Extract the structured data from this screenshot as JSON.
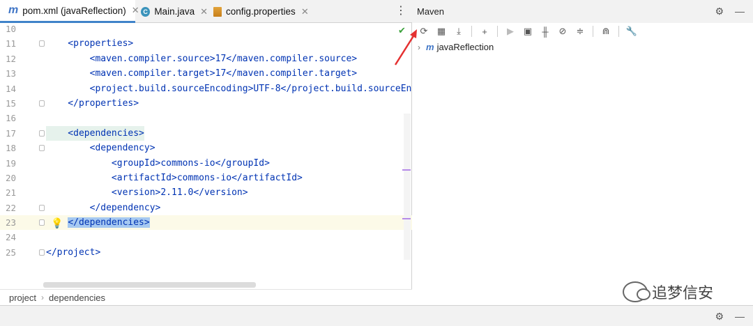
{
  "editor": {
    "tabs": [
      {
        "icon": "m",
        "label": "pom.xml (javaReflection)",
        "close": "✕"
      },
      {
        "icon": "C",
        "label": "Main.java",
        "close": "✕"
      },
      {
        "label": "config.properties",
        "close": "✕"
      }
    ],
    "more": "⋮",
    "lines": [
      {
        "n": "10",
        "code": ""
      },
      {
        "n": "11",
        "code": "    <properties>"
      },
      {
        "n": "12",
        "code": "        <maven.compiler.source>17</maven.compiler.source>"
      },
      {
        "n": "13",
        "code": "        <maven.compiler.target>17</maven.compiler.target>"
      },
      {
        "n": "14",
        "code": "        <project.build.sourceEncoding>UTF-8</project.build.sourceEnc"
      },
      {
        "n": "15",
        "code": "    </properties>"
      },
      {
        "n": "16",
        "code": ""
      },
      {
        "n": "17",
        "code": "    <dependencies>"
      },
      {
        "n": "18",
        "code": "        <dependency>"
      },
      {
        "n": "19",
        "code": "            <groupId>commons-io</groupId>"
      },
      {
        "n": "20",
        "code": "            <artifactId>commons-io</artifactId>"
      },
      {
        "n": "21",
        "code": "            <version>2.11.0</version>"
      },
      {
        "n": "22",
        "code": "        </dependency>"
      },
      {
        "n": "23",
        "code": "    </dependencies>"
      },
      {
        "n": "24",
        "code": ""
      },
      {
        "n": "25",
        "code": "</project>"
      }
    ],
    "breadcrumb": [
      "project",
      "dependencies"
    ]
  },
  "maven": {
    "title": "Maven",
    "project": "javaReflection"
  },
  "watermark": "追梦信安",
  "colors": {
    "tag": "#0033b3",
    "accent": "#4083c9",
    "arrow": "#e53030"
  }
}
